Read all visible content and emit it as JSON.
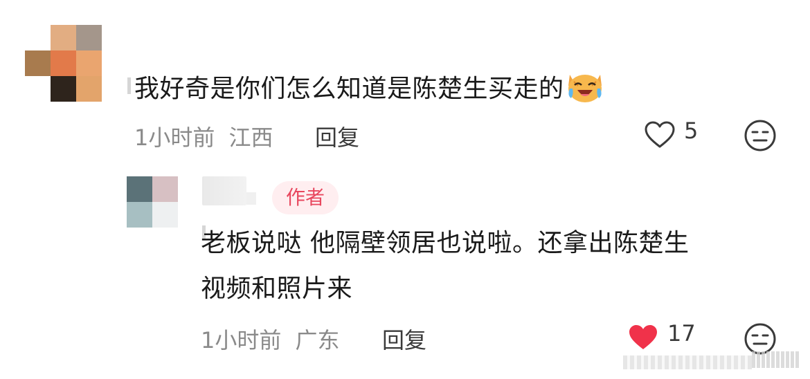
{
  "comment": {
    "text": "我好奇是你们怎么知道是陈楚生买走的",
    "emoji": "laughing-cat-icon",
    "time": "1小时前",
    "location": "江西",
    "reply_label": "回复",
    "like_count": "5",
    "liked": false
  },
  "reply": {
    "author_badge": "作者",
    "text_line1": "老板说哒 他隔壁领居也说啦。还拿出陈楚生",
    "text_line2": "视频和照片来",
    "time": "1小时前",
    "location": "广东",
    "reply_label": "回复",
    "like_count": "17",
    "liked": true
  },
  "colors": {
    "like_red": "#f0324a",
    "author_badge_text": "#e8475e",
    "author_badge_bg": "#ffeef0"
  }
}
